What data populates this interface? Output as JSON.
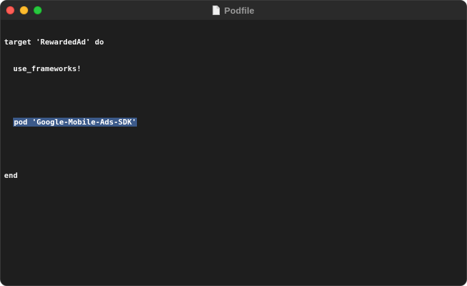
{
  "window": {
    "title": "Podfile"
  },
  "editor": {
    "lines": [
      "target 'RewardedAd' do",
      "  use_frameworks!",
      "",
      "  pod 'Google-Mobile-Ads-SDK'",
      "",
      "end"
    ],
    "selected_text": "pod 'Google-Mobile-Ads-SDK'"
  },
  "colors": {
    "background": "#1e1e1e",
    "selection": "#3c5a8a",
    "close": "#ff5f57",
    "minimize": "#febc2e",
    "zoom": "#28c840"
  },
  "icons": {
    "title_icon": "document-icon"
  }
}
